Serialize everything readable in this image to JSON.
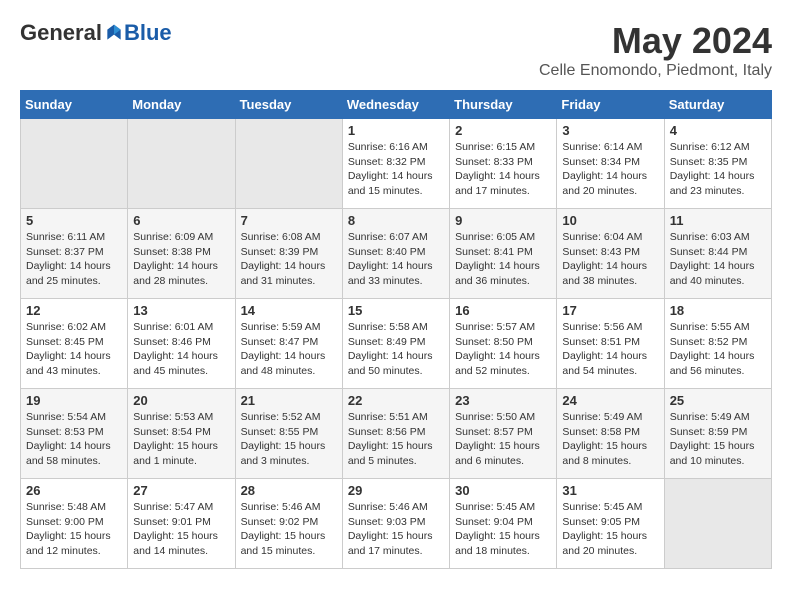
{
  "header": {
    "logo": {
      "general": "General",
      "blue": "Blue"
    },
    "title": "May 2024",
    "location": "Celle Enomondo, Piedmont, Italy"
  },
  "days_of_week": [
    "Sunday",
    "Monday",
    "Tuesday",
    "Wednesday",
    "Thursday",
    "Friday",
    "Saturday"
  ],
  "weeks": [
    [
      {
        "day": "",
        "info": ""
      },
      {
        "day": "",
        "info": ""
      },
      {
        "day": "",
        "info": ""
      },
      {
        "day": "1",
        "info": "Sunrise: 6:16 AM\nSunset: 8:32 PM\nDaylight: 14 hours and 15 minutes."
      },
      {
        "day": "2",
        "info": "Sunrise: 6:15 AM\nSunset: 8:33 PM\nDaylight: 14 hours and 17 minutes."
      },
      {
        "day": "3",
        "info": "Sunrise: 6:14 AM\nSunset: 8:34 PM\nDaylight: 14 hours and 20 minutes."
      },
      {
        "day": "4",
        "info": "Sunrise: 6:12 AM\nSunset: 8:35 PM\nDaylight: 14 hours and 23 minutes."
      }
    ],
    [
      {
        "day": "5",
        "info": "Sunrise: 6:11 AM\nSunset: 8:37 PM\nDaylight: 14 hours and 25 minutes."
      },
      {
        "day": "6",
        "info": "Sunrise: 6:09 AM\nSunset: 8:38 PM\nDaylight: 14 hours and 28 minutes."
      },
      {
        "day": "7",
        "info": "Sunrise: 6:08 AM\nSunset: 8:39 PM\nDaylight: 14 hours and 31 minutes."
      },
      {
        "day": "8",
        "info": "Sunrise: 6:07 AM\nSunset: 8:40 PM\nDaylight: 14 hours and 33 minutes."
      },
      {
        "day": "9",
        "info": "Sunrise: 6:05 AM\nSunset: 8:41 PM\nDaylight: 14 hours and 36 minutes."
      },
      {
        "day": "10",
        "info": "Sunrise: 6:04 AM\nSunset: 8:43 PM\nDaylight: 14 hours and 38 minutes."
      },
      {
        "day": "11",
        "info": "Sunrise: 6:03 AM\nSunset: 8:44 PM\nDaylight: 14 hours and 40 minutes."
      }
    ],
    [
      {
        "day": "12",
        "info": "Sunrise: 6:02 AM\nSunset: 8:45 PM\nDaylight: 14 hours and 43 minutes."
      },
      {
        "day": "13",
        "info": "Sunrise: 6:01 AM\nSunset: 8:46 PM\nDaylight: 14 hours and 45 minutes."
      },
      {
        "day": "14",
        "info": "Sunrise: 5:59 AM\nSunset: 8:47 PM\nDaylight: 14 hours and 48 minutes."
      },
      {
        "day": "15",
        "info": "Sunrise: 5:58 AM\nSunset: 8:49 PM\nDaylight: 14 hours and 50 minutes."
      },
      {
        "day": "16",
        "info": "Sunrise: 5:57 AM\nSunset: 8:50 PM\nDaylight: 14 hours and 52 minutes."
      },
      {
        "day": "17",
        "info": "Sunrise: 5:56 AM\nSunset: 8:51 PM\nDaylight: 14 hours and 54 minutes."
      },
      {
        "day": "18",
        "info": "Sunrise: 5:55 AM\nSunset: 8:52 PM\nDaylight: 14 hours and 56 minutes."
      }
    ],
    [
      {
        "day": "19",
        "info": "Sunrise: 5:54 AM\nSunset: 8:53 PM\nDaylight: 14 hours and 58 minutes."
      },
      {
        "day": "20",
        "info": "Sunrise: 5:53 AM\nSunset: 8:54 PM\nDaylight: 15 hours and 1 minute."
      },
      {
        "day": "21",
        "info": "Sunrise: 5:52 AM\nSunset: 8:55 PM\nDaylight: 15 hours and 3 minutes."
      },
      {
        "day": "22",
        "info": "Sunrise: 5:51 AM\nSunset: 8:56 PM\nDaylight: 15 hours and 5 minutes."
      },
      {
        "day": "23",
        "info": "Sunrise: 5:50 AM\nSunset: 8:57 PM\nDaylight: 15 hours and 6 minutes."
      },
      {
        "day": "24",
        "info": "Sunrise: 5:49 AM\nSunset: 8:58 PM\nDaylight: 15 hours and 8 minutes."
      },
      {
        "day": "25",
        "info": "Sunrise: 5:49 AM\nSunset: 8:59 PM\nDaylight: 15 hours and 10 minutes."
      }
    ],
    [
      {
        "day": "26",
        "info": "Sunrise: 5:48 AM\nSunset: 9:00 PM\nDaylight: 15 hours and 12 minutes."
      },
      {
        "day": "27",
        "info": "Sunrise: 5:47 AM\nSunset: 9:01 PM\nDaylight: 15 hours and 14 minutes."
      },
      {
        "day": "28",
        "info": "Sunrise: 5:46 AM\nSunset: 9:02 PM\nDaylight: 15 hours and 15 minutes."
      },
      {
        "day": "29",
        "info": "Sunrise: 5:46 AM\nSunset: 9:03 PM\nDaylight: 15 hours and 17 minutes."
      },
      {
        "day": "30",
        "info": "Sunrise: 5:45 AM\nSunset: 9:04 PM\nDaylight: 15 hours and 18 minutes."
      },
      {
        "day": "31",
        "info": "Sunrise: 5:45 AM\nSunset: 9:05 PM\nDaylight: 15 hours and 20 minutes."
      },
      {
        "day": "",
        "info": ""
      }
    ]
  ]
}
